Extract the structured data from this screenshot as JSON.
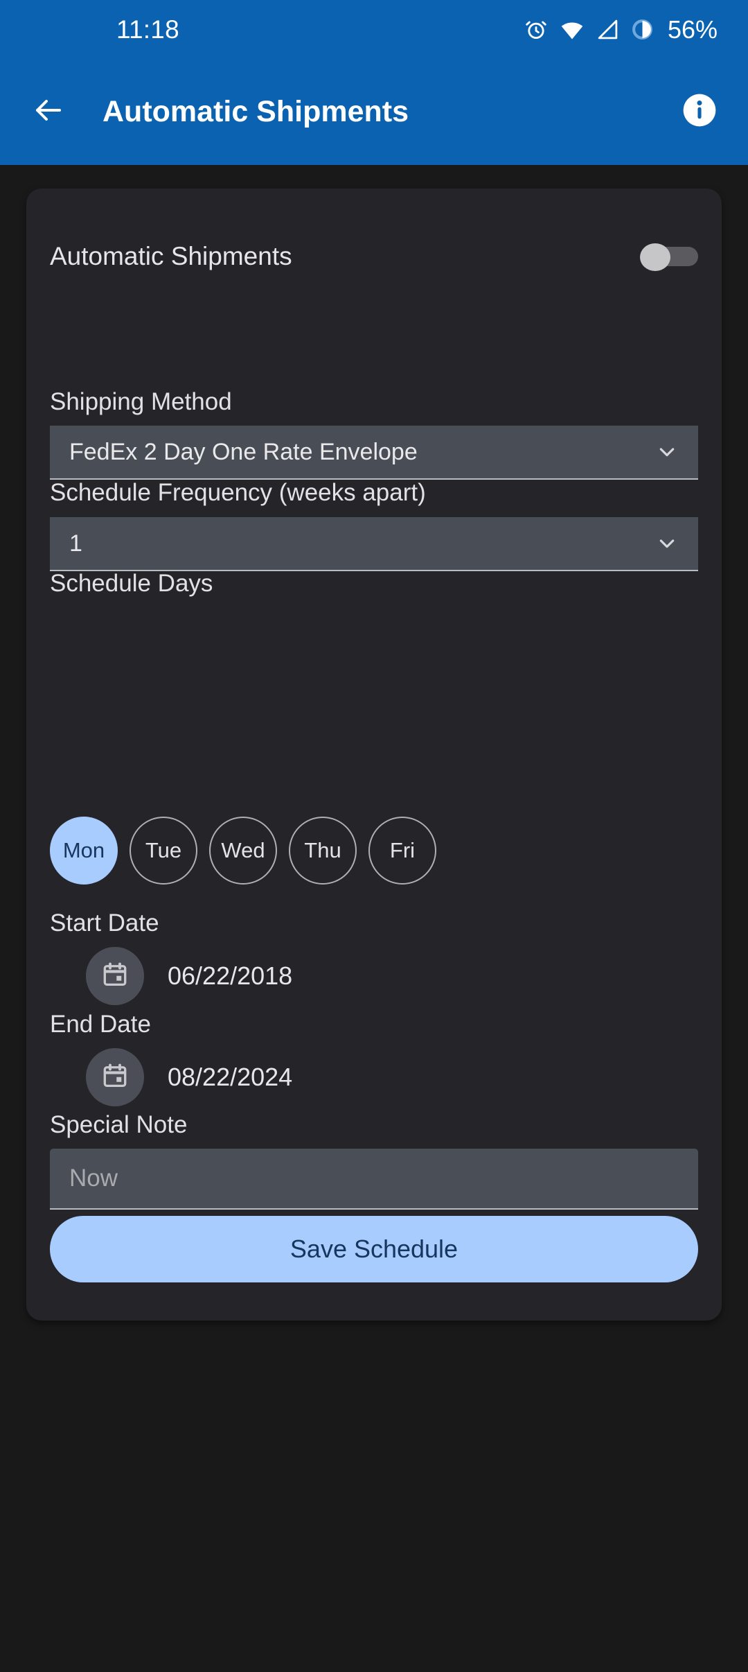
{
  "status_bar": {
    "time": "11:18",
    "battery_percent": "56%",
    "icons": [
      "alarm-icon",
      "wifi-icon",
      "signal-icon",
      "battery-icon"
    ]
  },
  "app_bar": {
    "title": "Automatic Shipments",
    "back_icon": "arrow-left-icon",
    "info_icon": "info-icon"
  },
  "form": {
    "toggle": {
      "label": "Automatic Shipments",
      "checked": false
    },
    "shipping_method": {
      "label": "Shipping Method",
      "value": "FedEx 2 Day One Rate Envelope",
      "chevron_icon": "chevron-down-icon"
    },
    "schedule_frequency": {
      "label": "Schedule Frequency (weeks apart)",
      "value": "1",
      "chevron_icon": "chevron-down-icon"
    },
    "schedule_days": {
      "label": "Schedule Days",
      "days": [
        {
          "label": "Mon",
          "selected": true
        },
        {
          "label": "Tue",
          "selected": false
        },
        {
          "label": "Wed",
          "selected": false
        },
        {
          "label": "Thu",
          "selected": false
        },
        {
          "label": "Fri",
          "selected": false
        }
      ]
    },
    "start_date": {
      "label": "Start Date",
      "value": "06/22/2018",
      "icon": "calendar-icon"
    },
    "end_date": {
      "label": "End Date",
      "value": "08/22/2024",
      "icon": "calendar-icon"
    },
    "special_note": {
      "label": "Special Note",
      "placeholder": "Now",
      "value": ""
    },
    "save_button": {
      "label": "Save Schedule"
    }
  },
  "colors": {
    "app_bar": "#0a62b0",
    "page_background": "#191919",
    "card_background": "#252529",
    "field_background": "#494d56",
    "accent": "#a9ccff",
    "accent_text": "#17365e"
  }
}
